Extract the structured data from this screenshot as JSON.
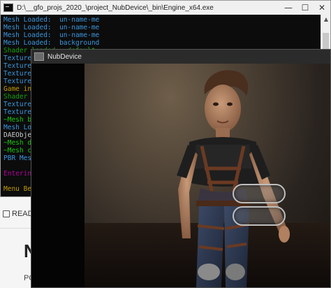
{
  "console_window": {
    "title": "D:\\__gfo_projs_2020_\\project_NubDevice\\_bin\\Engine_x64.exe",
    "minimize": "—",
    "maximize": "☐",
    "close": "✕",
    "scroll_up": "▲",
    "lines": [
      {
        "text": "Mesh Loaded:  un-name-me",
        "color": "#3a96dd"
      },
      {
        "text": "Mesh Loaded:  un-name-me",
        "color": "#3a96dd"
      },
      {
        "text": "Mesh Loaded:  un-name-me",
        "color": "#3a96dd"
      },
      {
        "text": "Mesh Loaded:  background",
        "color": "#3a96dd"
      },
      {
        "text": "Shader loaded:  default",
        "color": "#13a10e"
      },
      {
        "text": "Texture",
        "color": "#3a96dd"
      },
      {
        "text": "Texture",
        "color": "#3a96dd"
      },
      {
        "text": "Texture",
        "color": "#3a96dd"
      },
      {
        "text": "Texture",
        "color": "#3a96dd"
      },
      {
        "text": "Game in",
        "color": "#c19c00"
      },
      {
        "text": "Shader",
        "color": "#13a10e"
      },
      {
        "text": "Texture",
        "color": "#3a96dd"
      },
      {
        "text": "Texture",
        "color": "#3a96dd"
      },
      {
        "text": "~Mesh b",
        "color": "#16c60c"
      },
      {
        "text": "Mesh Lo",
        "color": "#3a96dd"
      },
      {
        "text": "DAEObje",
        "color": "#cccccc"
      },
      {
        "text": "~Mesh d",
        "color": "#16c60c"
      },
      {
        "text": "~Mesh c",
        "color": "#16c60c"
      },
      {
        "text": "PBR Mes",
        "color": "#3a96dd"
      },
      {
        "text": "",
        "color": "#cccccc"
      },
      {
        "text": "Enterin",
        "color": "#b4009e"
      },
      {
        "text": "",
        "color": "#cccccc"
      },
      {
        "text": "Menu Be",
        "color": "#c19c00"
      }
    ]
  },
  "nub_window": {
    "title": "NubDevice"
  },
  "background_page": {
    "readme_label": "READ",
    "big_text": "N",
    "small_text": "PO"
  },
  "colors": {
    "console_bg": "#0c0c0c",
    "accent_blue": "#3a96dd",
    "accent_green": "#13a10e",
    "accent_yellow": "#c19c00",
    "accent_magenta": "#b4009e"
  }
}
